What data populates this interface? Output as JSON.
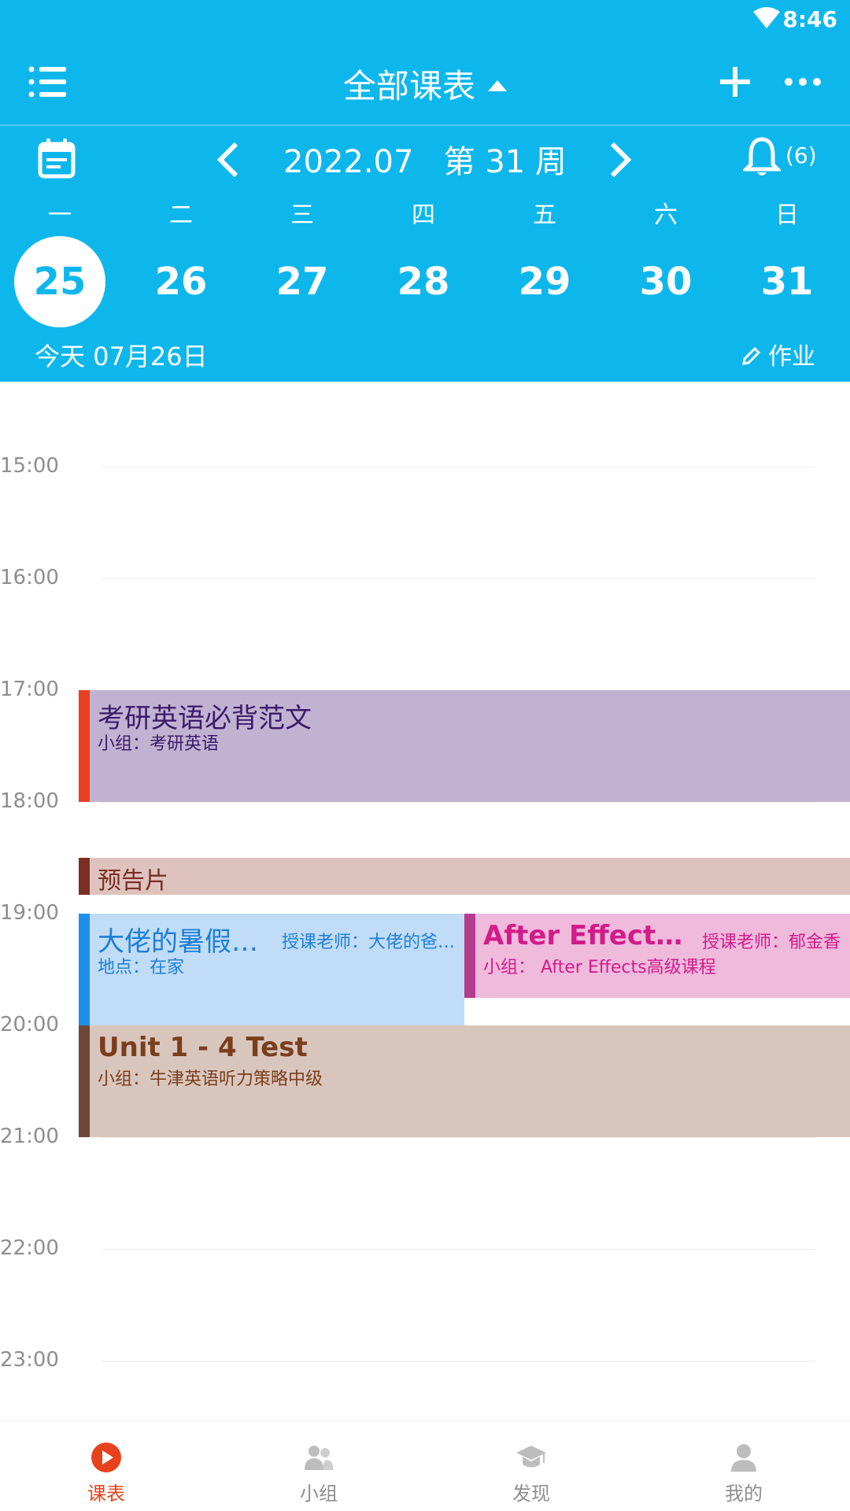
{
  "status_bar": {
    "time": "8:46"
  },
  "toolbar": {
    "title": "全部课表"
  },
  "week_nav": {
    "title": "2022.07   第 31 周",
    "notification_count": "(6)"
  },
  "weekdays": [
    "一",
    "二",
    "三",
    "四",
    "五",
    "六",
    "日"
  ],
  "dates": [
    "25",
    "26",
    "27",
    "28",
    "29",
    "30",
    "31"
  ],
  "selected_date": "25",
  "today_label": "今天 07月26日",
  "homework_label": "作业",
  "hours": [
    "15:00",
    "16:00",
    "17:00",
    "18:00",
    "19:00",
    "20:00",
    "21:00",
    "22:00",
    "23:00"
  ],
  "events": [
    {
      "title": "考研英语必背范文",
      "subtitle": "小组：考研英语",
      "start": "17:00",
      "end": "18:00",
      "bar_color": "#E83F22",
      "bg_color": "#C2B2D1",
      "title_color": "#3A1B6B",
      "sub_color": "#3A1B6B"
    },
    {
      "title": "预告片",
      "start": "18:30",
      "end": "18:50",
      "bar_color": "#7B2E22",
      "bg_color": "#DDC2BE",
      "title_color": "#7B2E22"
    },
    {
      "title": "大佬的暑假…",
      "teacher": "授课老师：大佬的爸…",
      "subtitle": "地点：在家",
      "start": "19:00",
      "end": "20:00",
      "bar_color": "#1E90E8",
      "bg_color": "#C0DCF7",
      "title_color": "#1E7FD6",
      "sub_color": "#1E7FD6"
    },
    {
      "title": "After Effect…",
      "teacher": "授课老师：郁金香",
      "subtitle": "小组： After Effects高级课程",
      "start": "19:00",
      "end": "19:45",
      "bar_color": "#B43C8C",
      "bg_color": "#F0BADD",
      "title_color": "#D11C8A",
      "sub_color": "#D11C8A"
    },
    {
      "title": "Unit 1 - 4 Test",
      "subtitle": "小组：牛津英语听力策略中级",
      "start": "20:00",
      "end": "21:00",
      "bar_color": "#6E4638",
      "bg_color": "#D8C6BC",
      "title_color": "#7A3E1D",
      "sub_color": "#7A3E1D"
    }
  ],
  "bottom_nav": [
    {
      "label": "课表",
      "icon": "play-circle-icon",
      "active": true
    },
    {
      "label": "小组",
      "icon": "group-icon",
      "active": false
    },
    {
      "label": "发现",
      "icon": "graduation-cap-icon",
      "active": false
    },
    {
      "label": "我的",
      "icon": "person-icon",
      "active": false
    }
  ],
  "colors": {
    "primary": "#0DB7EC",
    "accent": "#E8421C",
    "muted": "#8E8E8E"
  }
}
